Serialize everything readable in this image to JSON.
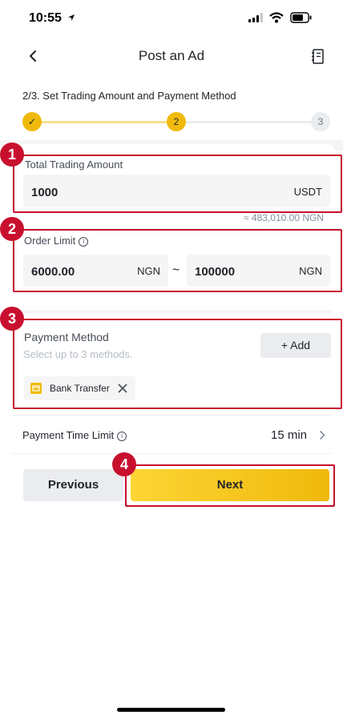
{
  "status_bar": {
    "time": "10:55"
  },
  "nav": {
    "title": "Post an Ad",
    "icons": [
      "back-chevron",
      "notebook-icon"
    ]
  },
  "steps": {
    "title": "2/3. Set Trading Amount and Payment Method",
    "step1": "✓",
    "step2": "2",
    "step3": "3",
    "current": 2
  },
  "trading": {
    "label": "Total Trading Amount",
    "value": "1000",
    "unit": "USDT",
    "approx": "≈ 483,010.00 NGN"
  },
  "order_limit": {
    "label": "Order Limit",
    "min_value": "6000.00",
    "min_unit": "NGN",
    "separator": "~",
    "max_value": "100000",
    "max_unit": "NGN"
  },
  "payment_method": {
    "label": "Payment Method",
    "hint": "Select up to 3 methods.",
    "add_label": "+ Add",
    "selected": [
      {
        "name": "Bank Transfer"
      }
    ]
  },
  "time_limit": {
    "label": "Payment Time Limit",
    "value": "15 min"
  },
  "actions": {
    "previous": "Previous",
    "next": "Next"
  },
  "annotations": [
    "1",
    "2",
    "3",
    "4"
  ],
  "colors": {
    "accent": "#f0b90b",
    "annotation_red": "#c8102e",
    "field_bg": "#f5f5f5",
    "button_grey": "#eaecef"
  }
}
